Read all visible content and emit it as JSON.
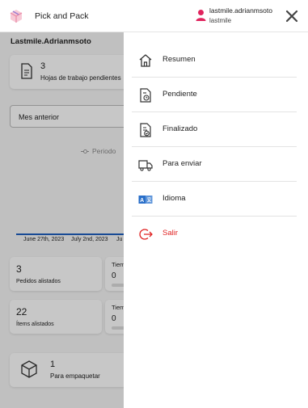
{
  "header": {
    "app_title": "Pick and Pack",
    "user_name": "lastmile.adrianmsoto",
    "user_role": "lastmile",
    "user_icon_color": "#e0245e"
  },
  "main": {
    "account_label": "Lastmile.Adrianmsoto",
    "sheets_card": {
      "count": "3",
      "label": "Hojas de trabajo pendientes"
    },
    "period_select": {
      "value": "Mes anterior"
    },
    "chart_legend": "Periodo",
    "chart_x_ticks": [
      "June 27th, 2023",
      "July 2nd, 2023",
      "Ju"
    ],
    "stats": [
      {
        "count": "3",
        "label": "Pedidos alistados"
      },
      {
        "count": "22",
        "label": "Ítems alistados"
      }
    ],
    "time_cards": [
      {
        "label": "Tiem",
        "value": "0"
      },
      {
        "label": "Tiem",
        "value": "0"
      }
    ],
    "pack_card": {
      "count": "1",
      "label": "Para empaquetar"
    }
  },
  "menu": {
    "items": [
      {
        "label": "Resumen",
        "icon": "home-icon"
      },
      {
        "label": "Pendiente",
        "icon": "pending-doc-icon"
      },
      {
        "label": "Finalizado",
        "icon": "finished-doc-icon"
      },
      {
        "label": "Para enviar",
        "icon": "truck-icon"
      },
      {
        "label": "Idioma",
        "icon": "language-icon"
      },
      {
        "label": "Salir",
        "icon": "logout-icon"
      }
    ],
    "danger_color": "#e02424",
    "accent_color": "#1f5fbf"
  }
}
